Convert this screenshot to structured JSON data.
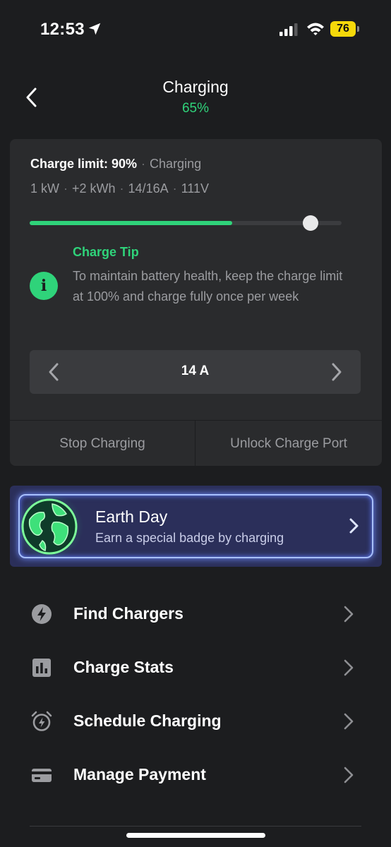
{
  "status_bar": {
    "time": "12:53",
    "battery_level": "76",
    "battery_color": "#f5d90a"
  },
  "header": {
    "title": "Charging",
    "subtitle": "65%",
    "back_icon": "chevron-left-icon"
  },
  "charge_card": {
    "limit_label": "Charge limit: 90%",
    "state": "Charging",
    "stats": [
      "1 kW",
      "+2 kWh",
      "14/16A",
      "111V"
    ],
    "separator": "·",
    "current_level_fraction": 0.65,
    "limit_fraction": 0.9,
    "tip": {
      "icon": "info-icon",
      "icon_glyph": "i",
      "title": "Charge Tip",
      "text": "To maintain battery health, keep the charge limit at 100% and charge fully once per week"
    },
    "amps": {
      "value": "14 A"
    },
    "actions": {
      "stop": "Stop Charging",
      "unlock": "Unlock Charge Port"
    }
  },
  "promo": {
    "title": "Earth Day",
    "subtitle": "Earn a special badge by charging",
    "icon": "globe-icon"
  },
  "menu": [
    {
      "label": "Find Chargers",
      "icon": "lightning-icon"
    },
    {
      "label": "Charge Stats",
      "icon": "bar-chart-icon"
    },
    {
      "label": "Schedule Charging",
      "icon": "alarm-clock-icon"
    },
    {
      "label": "Manage Payment",
      "icon": "credit-card-icon"
    }
  ],
  "colors": {
    "accent": "#2fd37a",
    "background": "#1c1d1f",
    "card": "#2a2b2d",
    "muted_text": "#9b9ca0",
    "promo_bg": "#2b2f5a"
  }
}
